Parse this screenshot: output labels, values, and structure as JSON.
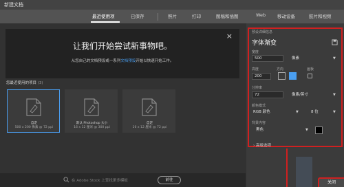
{
  "window": {
    "title": "新建文档"
  },
  "tabs": [
    {
      "label": "最近使用项",
      "active": true
    },
    {
      "label": "已保存"
    },
    {
      "label": "照片"
    },
    {
      "label": "打印"
    },
    {
      "label": "图稿和插图"
    },
    {
      "label": "Web"
    },
    {
      "label": "移动设备"
    },
    {
      "label": "胶片和视频"
    }
  ],
  "banner": {
    "heading": "让我们开始尝试新事物吧。",
    "subtitle_before": "从您自己的文档预设或一系列",
    "subtitle_link": "文档预设",
    "subtitle_after": "开始以快速开始工作。",
    "close": "×"
  },
  "recent": {
    "label": "您最近使用的项目",
    "count": "(3)",
    "items": [
      {
        "name": "自定",
        "size": "500 x 200 像素 @ 72 ppi",
        "selected": true
      },
      {
        "name": "默认 Photoshop 大小",
        "size": "16 x 12 厘米 @ 300 ppi"
      },
      {
        "name": "自定",
        "size": "16 x 12 厘米 @ 72 ppi"
      }
    ]
  },
  "search": {
    "placeholder": "在 Adobe Stock 上查找更多模板",
    "button": "前往"
  },
  "preset": {
    "section_label": "预设详细信息",
    "name": "字体渐变",
    "width_label": "宽度",
    "width_value": "500",
    "width_unit": "像素",
    "height_label": "高度",
    "height_value": "200",
    "orientation_label": "方向",
    "artboard_label": "画板",
    "resolution_label": "分辨率",
    "resolution_value": "72",
    "resolution_unit": "像素/英寸",
    "color_mode_label": "颜色模式",
    "color_mode_value": "RGB 颜色",
    "bit_depth_value": "8 位",
    "background_label": "背景内容",
    "background_value": "黑色",
    "background_color": "#000000",
    "advanced_label": "高级选项"
  },
  "footer": {
    "close_label": "关闭"
  },
  "colors": {
    "accent": "#4a9ef0",
    "highlight": "#d02020",
    "panel_bg": "#3b3b3b",
    "window_bg": "#323232"
  },
  "icons": [
    "save-icon",
    "close-icon",
    "search-icon",
    "document-icon",
    "chevron-down-icon",
    "portrait-icon",
    "landscape-icon"
  ]
}
